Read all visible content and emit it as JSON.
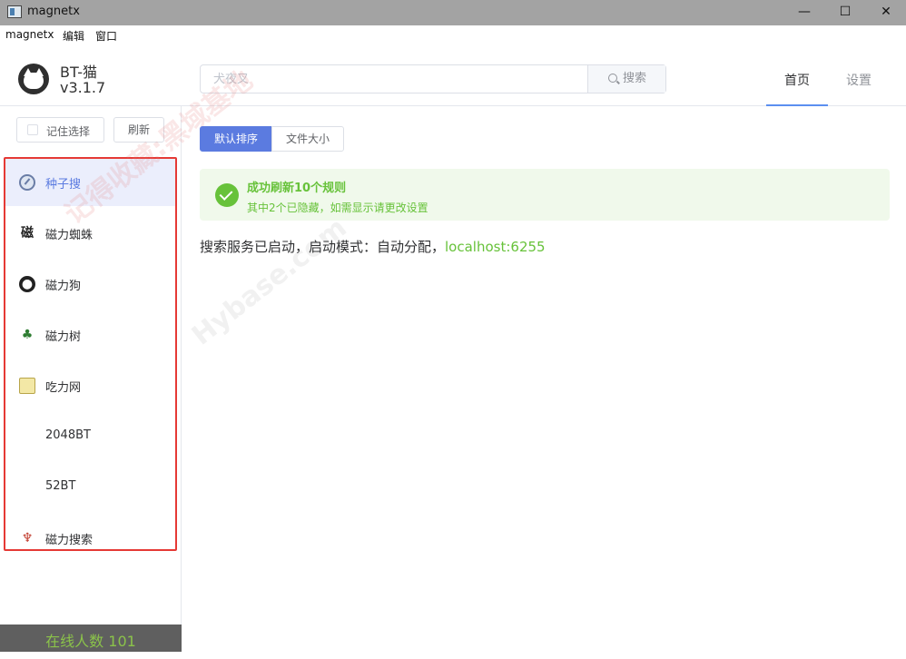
{
  "window": {
    "title": "magnetx",
    "controls": {
      "minimize": "—",
      "maximize": "☐",
      "close": "✕"
    }
  },
  "menu": [
    "magnetx",
    "编辑",
    "窗口"
  ],
  "brand": {
    "name": "BT-猫",
    "version": "v3.1.7"
  },
  "search": {
    "placeholder": "犬夜叉",
    "value": "",
    "button_label": "搜索"
  },
  "nav": {
    "home": "首页",
    "settings": "设置",
    "active": "home"
  },
  "sidebar": {
    "remember_label": "记住选择",
    "remember_checked": false,
    "refresh_label": "刷新",
    "rules": [
      {
        "label": "种子搜",
        "icon": "seed-icon",
        "active": true
      },
      {
        "label": "磁力蜘蛛",
        "icon": "spider-icon",
        "active": false
      },
      {
        "label": "磁力狗",
        "icon": "dog-icon",
        "active": false
      },
      {
        "label": "磁力树",
        "icon": "tree-icon",
        "active": false
      },
      {
        "label": "吃力网",
        "icon": "book-icon",
        "active": false
      },
      {
        "label": "2048BT",
        "icon": "",
        "active": false
      },
      {
        "label": "52BT",
        "icon": "",
        "active": false
      },
      {
        "label": "磁力搜索",
        "icon": "magnet-icon",
        "active": false
      }
    ],
    "online_count": "在线人数 101"
  },
  "watermark": {
    "text_cn": "记得收藏:黑域基地",
    "text_en": "Hybase.com"
  },
  "sort": {
    "default_label": "默认排序",
    "size_label": "文件大小",
    "active": "default"
  },
  "alert": {
    "title": "成功刷新10个规则",
    "description": "其中2个已隐藏，如需显示请更改设置",
    "type": "success"
  },
  "status": {
    "text": "搜索服务已启动，启动模式：自动分配，",
    "address": "localhost:6255"
  },
  "colors": {
    "accent": "#5b7be0",
    "success": "#67c23a",
    "alert_bg": "#f0f9eb",
    "highlight_border": "#e53935"
  }
}
